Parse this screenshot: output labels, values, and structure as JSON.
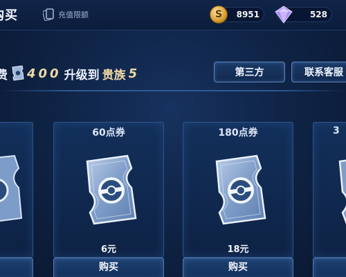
{
  "header": {
    "title": "购买",
    "recharge_limit_label": "充值限额",
    "coins": "8951",
    "gems": "528"
  },
  "promo": {
    "prefix": "费",
    "amount": "400",
    "middle": "升级到",
    "level_name": "贵族",
    "level_num": "5"
  },
  "buttons": {
    "third_party": "第三方",
    "support": "联系客服"
  },
  "cards": [
    {
      "title": "",
      "price": "",
      "buy_label": ""
    },
    {
      "title": "60点券",
      "price": "6元",
      "buy_label": "购买"
    },
    {
      "title": "180点券",
      "price": "18元",
      "buy_label": "购买"
    },
    {
      "title": "3",
      "price": "",
      "buy_label": ""
    }
  ],
  "colors": {
    "background": "#0f2447",
    "accent_gold": "#f0d9a6",
    "button_border": "#5d85bf"
  }
}
